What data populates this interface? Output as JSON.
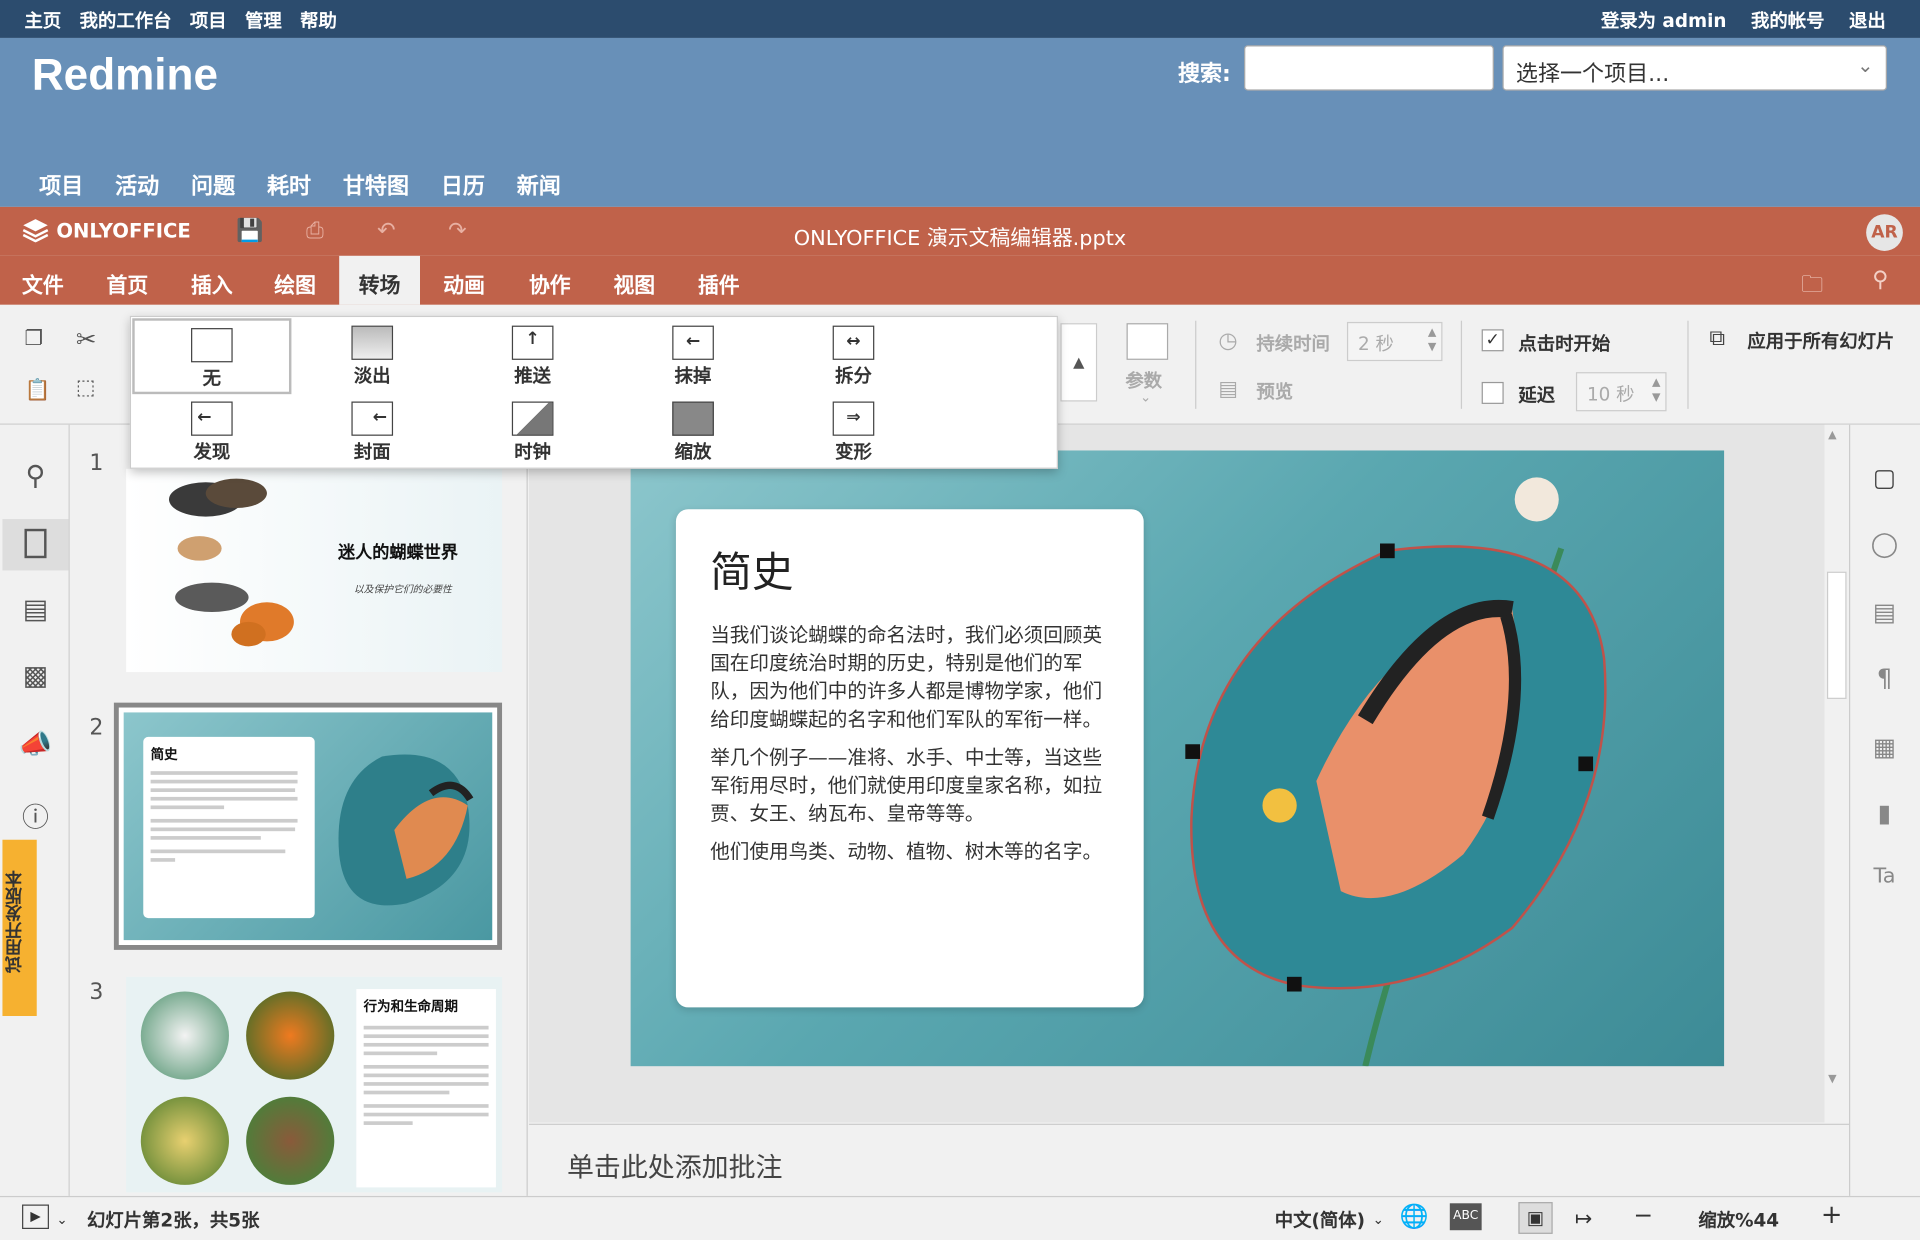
{
  "redmine": {
    "top_left": [
      "主页",
      "我的工作台",
      "项目",
      "管理",
      "帮助"
    ],
    "logged_in": "登录为 admin",
    "account": "我的帐号",
    "logout": "退出",
    "title": "Redmine",
    "search_label": "搜索:",
    "project_select": "选择一个项目...",
    "menu": [
      "项目",
      "活动",
      "问题",
      "耗时",
      "甘特图",
      "日历",
      "新闻"
    ]
  },
  "onlyoffice": {
    "logo": "ONLYOFFICE",
    "doc_title": "ONLYOFFICE 演示文稿编辑器.pptx",
    "avatar": "AR",
    "tabs": [
      "文件",
      "首页",
      "插入",
      "绘图",
      "转场",
      "动画",
      "协作",
      "视图",
      "插件"
    ],
    "active_tab": "转场"
  },
  "toolbar": {
    "params": "参数",
    "duration_label": "持续时间",
    "duration_value": "2 秒",
    "preview": "预览",
    "start_on_click": "点击时开始",
    "start_on_click_checked": true,
    "delay_label": "延迟",
    "delay_checked": false,
    "delay_value": "10 秒",
    "apply_all": "应用于所有幻灯片"
  },
  "transitions": [
    "无",
    "淡出",
    "推送",
    "抹掉",
    "拆分",
    "发现",
    "封面",
    "时钟",
    "缩放",
    "变形"
  ],
  "transitions_selected": "无",
  "trial_label": "试用开发版本",
  "slides": {
    "numbers": [
      "1",
      "2",
      "3"
    ],
    "s1_title": "迷人的蝴蝶世界",
    "s1_subtitle": "以及保护它们的必要性",
    "s2_title": "简史",
    "s3_title": "行为和生命周期"
  },
  "current_slide": {
    "title": "简史",
    "paragraphs": [
      "当我们谈论蝴蝶的命名法时，我们必须回顾英国在印度统治时期的历史，特别是他们的军队，因为他们中的许多人都是博物学家，他们给印度蝴蝶起的名字和他们军队的军衔一样。",
      "举几个例子——准将、水手、中士等，当这些军衔用尽时，他们就使用印度皇家名称，如拉贾、女王、纳瓦布、皇帝等等。",
      "他们使用鸟类、动物、植物、树木等的名字。"
    ]
  },
  "notes_placeholder": "单击此处添加批注",
  "status": {
    "slide_info": "幻灯片第2张，共5张",
    "language": "中文(简体)",
    "zoom": "缩放%44"
  },
  "colors": {
    "redmine_top": "#2c4c6e",
    "redmine_head": "#6890b8",
    "onlyoffice": "#c0624a",
    "trial": "#f6b130"
  }
}
